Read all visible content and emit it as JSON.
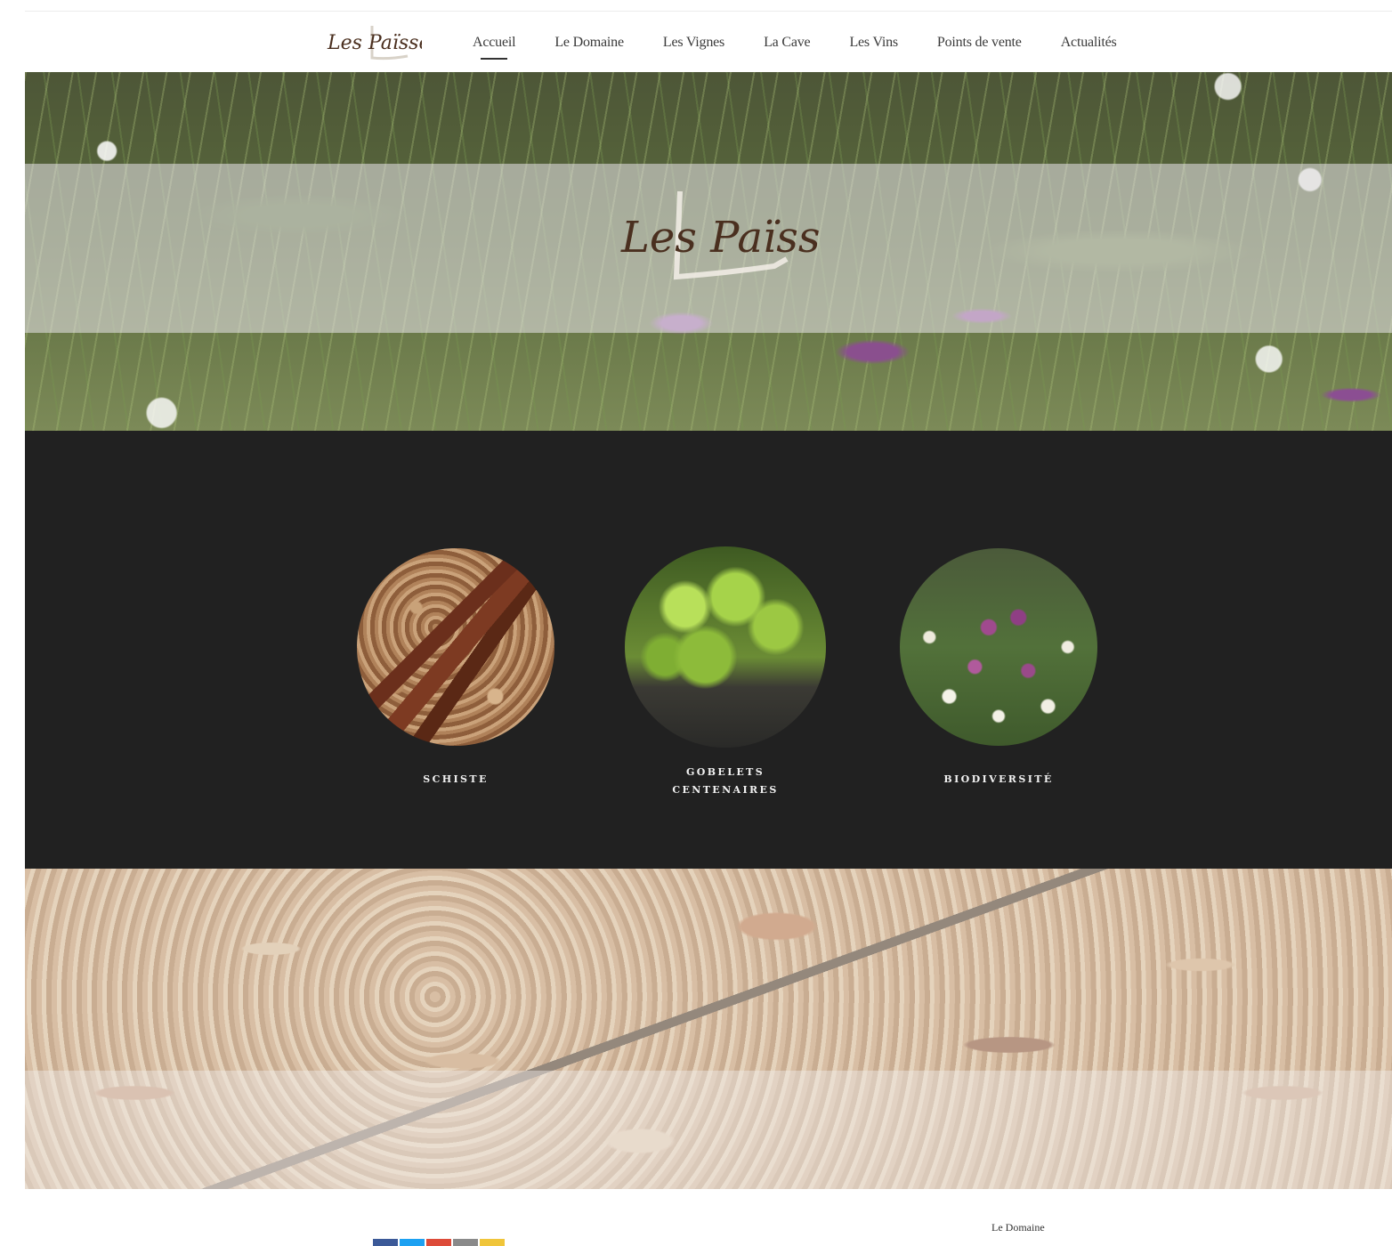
{
  "header": {
    "logo_text": "Les Païssels",
    "nav": [
      {
        "label": "Accueil",
        "active": true
      },
      {
        "label": "Le Domaine",
        "active": false
      },
      {
        "label": "Les Vignes",
        "active": false
      },
      {
        "label": "La Cave",
        "active": false
      },
      {
        "label": "Les Vins",
        "active": false
      },
      {
        "label": "Points de vente",
        "active": false
      },
      {
        "label": "Actualités",
        "active": false
      }
    ]
  },
  "hero": {
    "logo_text": "Les Païssels"
  },
  "features": {
    "items": [
      {
        "label": "Schiste",
        "image": "schist-rock-photo"
      },
      {
        "label": "Gobelets centenaires",
        "image": "vine-bush-photo"
      },
      {
        "label": "Biodiversité",
        "image": "wildflowers-photo"
      }
    ]
  },
  "footer": {
    "link_label": "Le Domaine",
    "social_icons": [
      "facebook-icon",
      "twitter-icon",
      "google-plus-icon",
      "email-icon",
      "share-icon"
    ],
    "social_colors": [
      "#3b5998",
      "#1da1f2",
      "#dd4b39",
      "#8a8a8a",
      "#f0c53a"
    ]
  },
  "colors": {
    "logo": "#4a2f1f",
    "dark_section": "#212121"
  }
}
